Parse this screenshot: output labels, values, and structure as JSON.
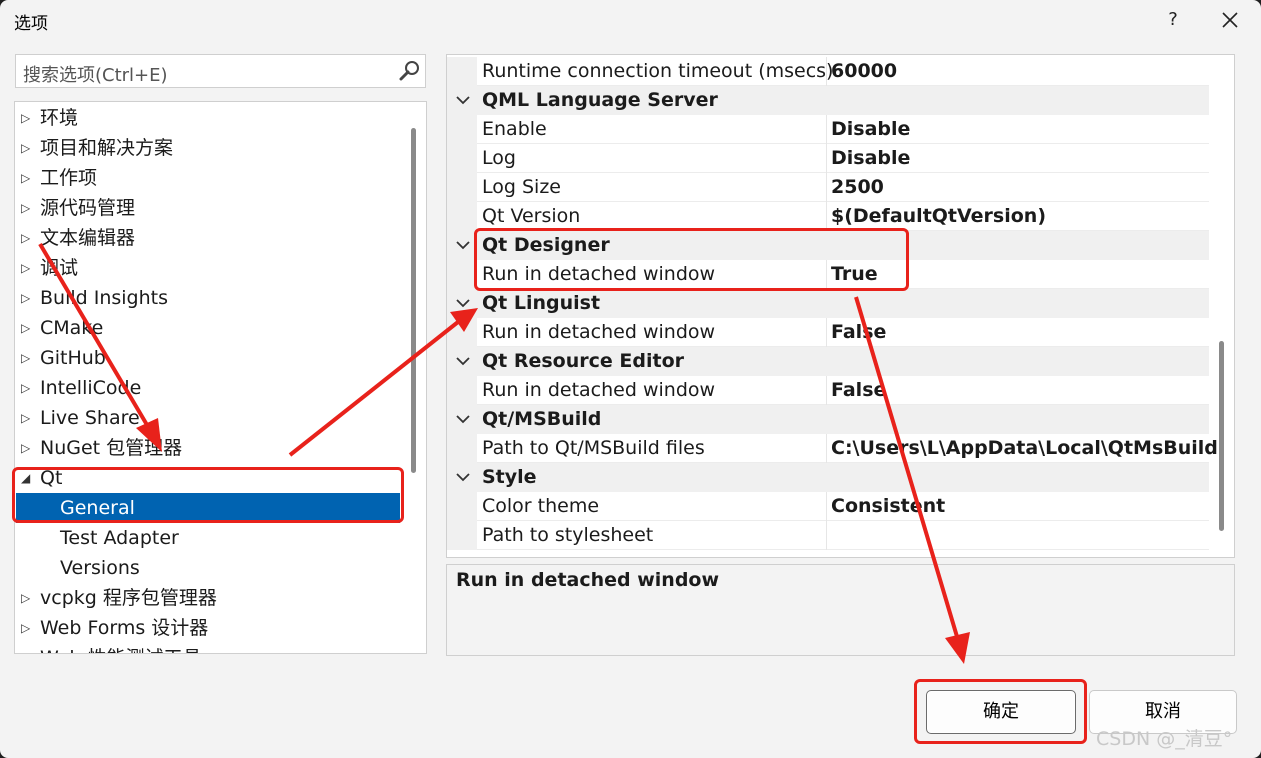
{
  "window": {
    "title": "选项",
    "help_label": "?"
  },
  "search": {
    "placeholder": "搜索选项(Ctrl+E)"
  },
  "tree": {
    "items": [
      {
        "label": "环境",
        "expanded": false
      },
      {
        "label": "项目和解决方案",
        "expanded": false
      },
      {
        "label": "工作项",
        "expanded": false
      },
      {
        "label": "源代码管理",
        "expanded": false
      },
      {
        "label": "文本编辑器",
        "expanded": false
      },
      {
        "label": "调试",
        "expanded": false
      },
      {
        "label": "Build Insights",
        "expanded": false
      },
      {
        "label": "CMake",
        "expanded": false
      },
      {
        "label": "GitHub",
        "expanded": false
      },
      {
        "label": "IntelliCode",
        "expanded": false
      },
      {
        "label": "Live Share",
        "expanded": false
      },
      {
        "label": "NuGet 包管理器",
        "expanded": false
      },
      {
        "label": "Qt",
        "expanded": true
      },
      {
        "label": "General",
        "selected": true
      },
      {
        "label": "Test Adapter"
      },
      {
        "label": "Versions"
      },
      {
        "label": "vcpkg 程序包管理器",
        "expanded": false
      },
      {
        "label": "Web Forms 设计器",
        "expanded": false
      },
      {
        "label": "Web 性能测试工具",
        "expanded": false
      }
    ]
  },
  "grid": {
    "rows": [
      {
        "type": "prop",
        "name": "Runtime connection timeout (msecs)",
        "value": "60000"
      },
      {
        "type": "cat",
        "name": "QML Language Server"
      },
      {
        "type": "prop",
        "name": "Enable",
        "value": "Disable"
      },
      {
        "type": "prop",
        "name": "Log",
        "value": "Disable"
      },
      {
        "type": "prop",
        "name": "Log Size",
        "value": "2500"
      },
      {
        "type": "prop",
        "name": "Qt Version",
        "value": "$(DefaultQtVersion)"
      },
      {
        "type": "cat",
        "name": "Qt Designer"
      },
      {
        "type": "prop",
        "name": "Run in detached window",
        "value": "True"
      },
      {
        "type": "cat",
        "name": "Qt Linguist"
      },
      {
        "type": "prop",
        "name": "Run in detached window",
        "value": "False"
      },
      {
        "type": "cat",
        "name": "Qt Resource Editor"
      },
      {
        "type": "prop",
        "name": "Run in detached window",
        "value": "False"
      },
      {
        "type": "cat",
        "name": "Qt/MSBuild"
      },
      {
        "type": "prop",
        "name": "Path to Qt/MSBuild files",
        "value": "C:\\Users\\L\\AppData\\Local\\QtMsBuild"
      },
      {
        "type": "cat",
        "name": "Style"
      },
      {
        "type": "prop",
        "name": "Color theme",
        "value": "Consistent"
      },
      {
        "type": "prop",
        "name": "Path to stylesheet",
        "value": ""
      }
    ]
  },
  "description": {
    "title": "Run in detached window"
  },
  "buttons": {
    "ok": "确定",
    "cancel": "取消"
  },
  "watermark": "CSDN @_清豆°",
  "colors": {
    "selection": "#0063b1",
    "annotation": "#e8221b"
  }
}
